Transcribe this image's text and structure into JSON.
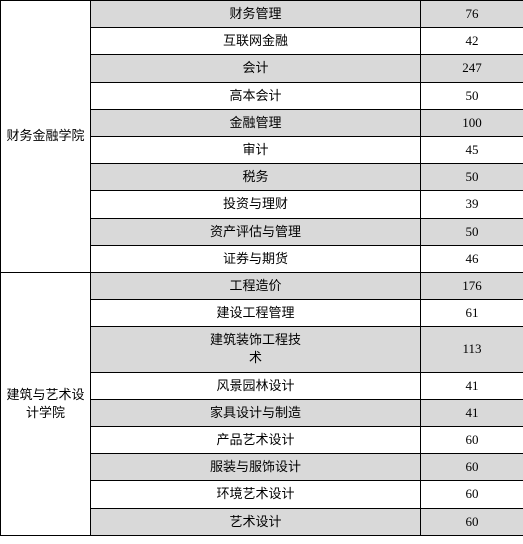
{
  "table": {
    "rows": [
      {
        "school": "财务金融学院",
        "major": "财务管理",
        "num": "76",
        "schoolRowspan": 10,
        "majorRowspan": 1,
        "highlight": true
      },
      {
        "school": "",
        "major": "互联网金融",
        "num": "42",
        "majorRowspan": 1,
        "highlight": false
      },
      {
        "school": "",
        "major": "会计",
        "num": "247",
        "majorRowspan": 1,
        "highlight": true
      },
      {
        "school": "",
        "major": "高本会计",
        "num": "50",
        "majorRowspan": 1,
        "highlight": false
      },
      {
        "school": "",
        "major": "金融管理",
        "num": "100",
        "majorRowspan": 1,
        "highlight": true
      },
      {
        "school": "",
        "major": "审计",
        "num": "45",
        "majorRowspan": 1,
        "highlight": false
      },
      {
        "school": "",
        "major": "税务",
        "num": "50",
        "majorRowspan": 1,
        "highlight": true
      },
      {
        "school": "",
        "major": "投资与理财",
        "num": "39",
        "majorRowspan": 1,
        "highlight": false
      },
      {
        "school": "",
        "major": "资产评估与管理",
        "num": "50",
        "majorRowspan": 1,
        "highlight": true
      },
      {
        "school": "",
        "major": "证券与期货",
        "num": "46",
        "majorRowspan": 1,
        "highlight": false
      },
      {
        "school": "建筑与艺术设计学院",
        "major": "工程造价",
        "num": "176",
        "schoolRowspan": 10,
        "majorRowspan": 1,
        "highlight": true
      },
      {
        "school": "",
        "major": "建设工程管理",
        "num": "61",
        "majorRowspan": 1,
        "highlight": false
      },
      {
        "school": "",
        "major": "建筑装饰工程技术",
        "num": "113",
        "majorRowspan": 1,
        "highlight": true
      },
      {
        "school": "",
        "major": "风景园林设计",
        "num": "41",
        "majorRowspan": 1,
        "highlight": false
      },
      {
        "school": "",
        "major": "家具设计与制造",
        "num": "41",
        "majorRowspan": 1,
        "highlight": true
      },
      {
        "school": "",
        "major": "产品艺术设计",
        "num": "60",
        "majorRowspan": 1,
        "highlight": false
      },
      {
        "school": "",
        "major": "服装与服饰设计",
        "num": "60",
        "majorRowspan": 1,
        "highlight": true
      },
      {
        "school": "",
        "major": "环境艺术设计",
        "num": "60",
        "majorRowspan": 1,
        "highlight": false
      },
      {
        "school": "",
        "major": "艺术设计",
        "num": "60",
        "majorRowspan": 1,
        "highlight": true
      }
    ]
  }
}
